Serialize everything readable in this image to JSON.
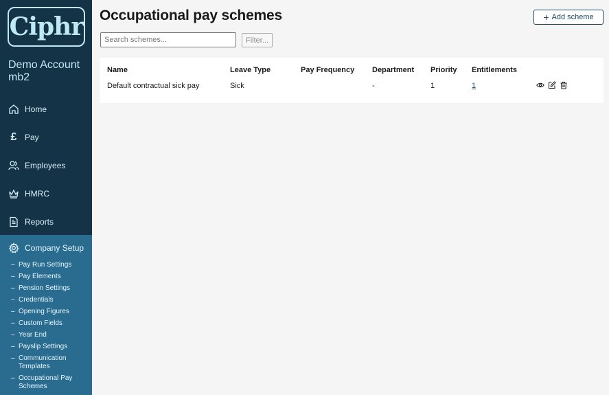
{
  "sidebar": {
    "logo": "Ciphr",
    "account_line1": "Demo Account",
    "account_line2": "mb2",
    "nav": [
      {
        "label": "Home",
        "icon": "home-icon"
      },
      {
        "label": "Pay",
        "icon": "pound-icon"
      },
      {
        "label": "Employees",
        "icon": "users-icon"
      },
      {
        "label": "HMRC",
        "icon": "crown-icon"
      },
      {
        "label": "Reports",
        "icon": "document-icon"
      }
    ],
    "setup": {
      "label": "Company Setup",
      "icon": "gear-icon",
      "items": [
        "Pay Run Settings",
        "Pay Elements",
        "Pension Settings",
        "Credentials",
        "Opening Figures",
        "Custom Fields",
        "Year End",
        "Payslip Settings",
        "Communication Templates",
        "Occupational Pay Schemes"
      ]
    }
  },
  "header": {
    "title": "Occupational pay schemes",
    "add_button": "Add scheme"
  },
  "search": {
    "placeholder": "Search schemes...",
    "value": ""
  },
  "filter_label": "Filter...",
  "table": {
    "columns": [
      "Name",
      "Leave Type",
      "Pay Frequency",
      "Department",
      "Priority",
      "Entitlements"
    ],
    "rows": [
      {
        "name": "Default contractual sick pay",
        "leave_type": "Sick",
        "pay_frequency": "",
        "department": "-",
        "priority": "1",
        "entitlements": "1"
      }
    ]
  },
  "colors": {
    "sidebar": "#143346",
    "setup": "#2a6c90",
    "accent": "#1d4a63",
    "logo": "#bfe9f2"
  }
}
